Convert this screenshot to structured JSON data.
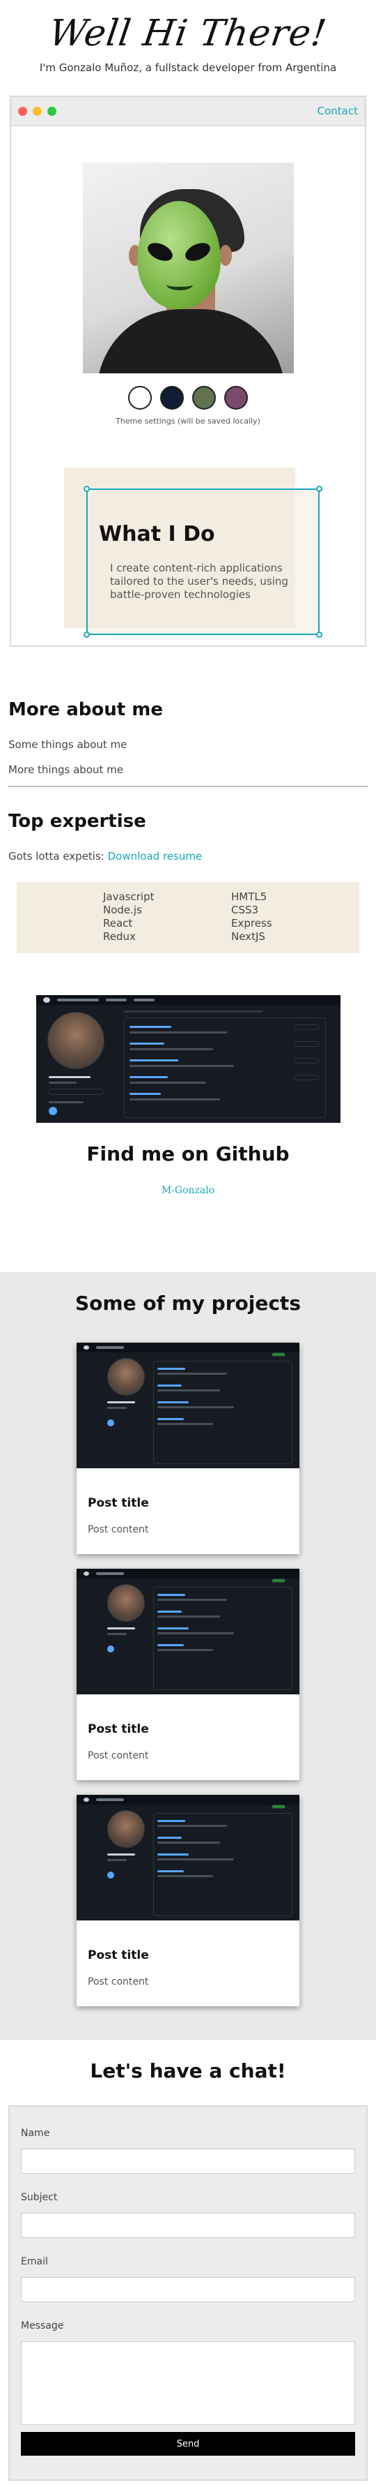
{
  "hero": {
    "title": "Well Hi There!",
    "subtitle": "I'm Gonzalo Muñoz, a fullstack developer from Argentina"
  },
  "browser": {
    "contact_label": "Contact",
    "traffic_colors": [
      "#ff5f57",
      "#febc2e",
      "#28c840"
    ],
    "photo_overlay_icon": "alien-emoji-icon"
  },
  "theme": {
    "swatches": [
      {
        "name": "white",
        "color": "#ffffff"
      },
      {
        "name": "navy",
        "color": "#111d33"
      },
      {
        "name": "olive",
        "color": "#5f7351"
      },
      {
        "name": "plum",
        "color": "#7a4a6d"
      }
    ],
    "note": "Theme settings (will be saved locally)"
  },
  "what_i_do": {
    "title": "What I Do",
    "text": "I create content-rich applications tailored to the user's needs, using battle-proven technologies"
  },
  "more_about": {
    "title": "More about me",
    "items": [
      "Some things about me",
      "More things about me"
    ]
  },
  "expertise": {
    "title": "Top expertise",
    "gots_text": "Gots lotta expetis: ",
    "resume_link": "Download resume",
    "skills_left": [
      "Javascript",
      "Node.js",
      "React",
      "Redux"
    ],
    "skills_right": [
      "HMTL5",
      "CSS3",
      "Express",
      "NextJS"
    ]
  },
  "github": {
    "title": "Find me on Github",
    "link": "M-Gonzalo"
  },
  "projects": {
    "title": "Some of my projects",
    "items": [
      {
        "title": "Post title",
        "content": "Post content"
      },
      {
        "title": "Post title",
        "content": "Post content"
      },
      {
        "title": "Post title",
        "content": "Post content"
      }
    ]
  },
  "chat": {
    "title": "Let's have a chat!",
    "fields": {
      "name": "Name",
      "subject": "Subject",
      "email": "Email",
      "message": "Message"
    },
    "send_label": "Send"
  },
  "colors": {
    "accent": "#1aa7b5",
    "cream": "#f3ede1",
    "section_gray": "#e9e9e9"
  }
}
